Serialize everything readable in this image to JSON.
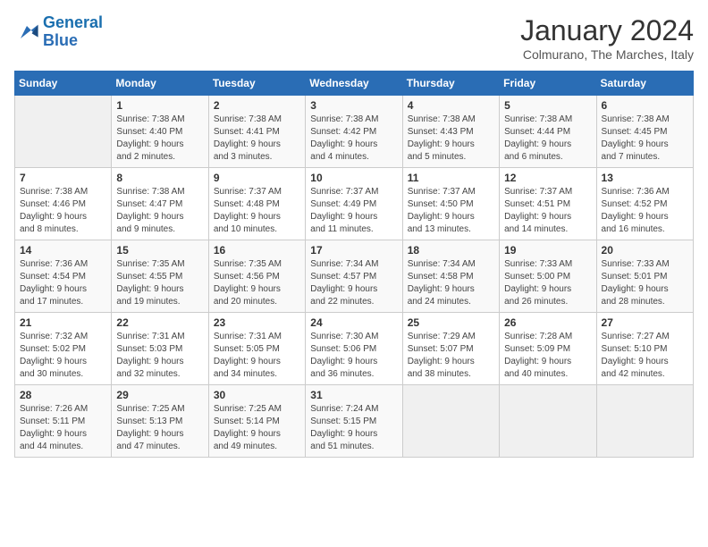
{
  "logo": {
    "line1": "General",
    "line2": "Blue"
  },
  "title": "January 2024",
  "subtitle": "Colmurano, The Marches, Italy",
  "days_header": [
    "Sunday",
    "Monday",
    "Tuesday",
    "Wednesday",
    "Thursday",
    "Friday",
    "Saturday"
  ],
  "weeks": [
    [
      {
        "day": "",
        "info": ""
      },
      {
        "day": "1",
        "info": "Sunrise: 7:38 AM\nSunset: 4:40 PM\nDaylight: 9 hours\nand 2 minutes."
      },
      {
        "day": "2",
        "info": "Sunrise: 7:38 AM\nSunset: 4:41 PM\nDaylight: 9 hours\nand 3 minutes."
      },
      {
        "day": "3",
        "info": "Sunrise: 7:38 AM\nSunset: 4:42 PM\nDaylight: 9 hours\nand 4 minutes."
      },
      {
        "day": "4",
        "info": "Sunrise: 7:38 AM\nSunset: 4:43 PM\nDaylight: 9 hours\nand 5 minutes."
      },
      {
        "day": "5",
        "info": "Sunrise: 7:38 AM\nSunset: 4:44 PM\nDaylight: 9 hours\nand 6 minutes."
      },
      {
        "day": "6",
        "info": "Sunrise: 7:38 AM\nSunset: 4:45 PM\nDaylight: 9 hours\nand 7 minutes."
      }
    ],
    [
      {
        "day": "7",
        "info": "Sunrise: 7:38 AM\nSunset: 4:46 PM\nDaylight: 9 hours\nand 8 minutes."
      },
      {
        "day": "8",
        "info": "Sunrise: 7:38 AM\nSunset: 4:47 PM\nDaylight: 9 hours\nand 9 minutes."
      },
      {
        "day": "9",
        "info": "Sunrise: 7:37 AM\nSunset: 4:48 PM\nDaylight: 9 hours\nand 10 minutes."
      },
      {
        "day": "10",
        "info": "Sunrise: 7:37 AM\nSunset: 4:49 PM\nDaylight: 9 hours\nand 11 minutes."
      },
      {
        "day": "11",
        "info": "Sunrise: 7:37 AM\nSunset: 4:50 PM\nDaylight: 9 hours\nand 13 minutes."
      },
      {
        "day": "12",
        "info": "Sunrise: 7:37 AM\nSunset: 4:51 PM\nDaylight: 9 hours\nand 14 minutes."
      },
      {
        "day": "13",
        "info": "Sunrise: 7:36 AM\nSunset: 4:52 PM\nDaylight: 9 hours\nand 16 minutes."
      }
    ],
    [
      {
        "day": "14",
        "info": "Sunrise: 7:36 AM\nSunset: 4:54 PM\nDaylight: 9 hours\nand 17 minutes."
      },
      {
        "day": "15",
        "info": "Sunrise: 7:35 AM\nSunset: 4:55 PM\nDaylight: 9 hours\nand 19 minutes."
      },
      {
        "day": "16",
        "info": "Sunrise: 7:35 AM\nSunset: 4:56 PM\nDaylight: 9 hours\nand 20 minutes."
      },
      {
        "day": "17",
        "info": "Sunrise: 7:34 AM\nSunset: 4:57 PM\nDaylight: 9 hours\nand 22 minutes."
      },
      {
        "day": "18",
        "info": "Sunrise: 7:34 AM\nSunset: 4:58 PM\nDaylight: 9 hours\nand 24 minutes."
      },
      {
        "day": "19",
        "info": "Sunrise: 7:33 AM\nSunset: 5:00 PM\nDaylight: 9 hours\nand 26 minutes."
      },
      {
        "day": "20",
        "info": "Sunrise: 7:33 AM\nSunset: 5:01 PM\nDaylight: 9 hours\nand 28 minutes."
      }
    ],
    [
      {
        "day": "21",
        "info": "Sunrise: 7:32 AM\nSunset: 5:02 PM\nDaylight: 9 hours\nand 30 minutes."
      },
      {
        "day": "22",
        "info": "Sunrise: 7:31 AM\nSunset: 5:03 PM\nDaylight: 9 hours\nand 32 minutes."
      },
      {
        "day": "23",
        "info": "Sunrise: 7:31 AM\nSunset: 5:05 PM\nDaylight: 9 hours\nand 34 minutes."
      },
      {
        "day": "24",
        "info": "Sunrise: 7:30 AM\nSunset: 5:06 PM\nDaylight: 9 hours\nand 36 minutes."
      },
      {
        "day": "25",
        "info": "Sunrise: 7:29 AM\nSunset: 5:07 PM\nDaylight: 9 hours\nand 38 minutes."
      },
      {
        "day": "26",
        "info": "Sunrise: 7:28 AM\nSunset: 5:09 PM\nDaylight: 9 hours\nand 40 minutes."
      },
      {
        "day": "27",
        "info": "Sunrise: 7:27 AM\nSunset: 5:10 PM\nDaylight: 9 hours\nand 42 minutes."
      }
    ],
    [
      {
        "day": "28",
        "info": "Sunrise: 7:26 AM\nSunset: 5:11 PM\nDaylight: 9 hours\nand 44 minutes."
      },
      {
        "day": "29",
        "info": "Sunrise: 7:25 AM\nSunset: 5:13 PM\nDaylight: 9 hours\nand 47 minutes."
      },
      {
        "day": "30",
        "info": "Sunrise: 7:25 AM\nSunset: 5:14 PM\nDaylight: 9 hours\nand 49 minutes."
      },
      {
        "day": "31",
        "info": "Sunrise: 7:24 AM\nSunset: 5:15 PM\nDaylight: 9 hours\nand 51 minutes."
      },
      {
        "day": "",
        "info": ""
      },
      {
        "day": "",
        "info": ""
      },
      {
        "day": "",
        "info": ""
      }
    ]
  ]
}
